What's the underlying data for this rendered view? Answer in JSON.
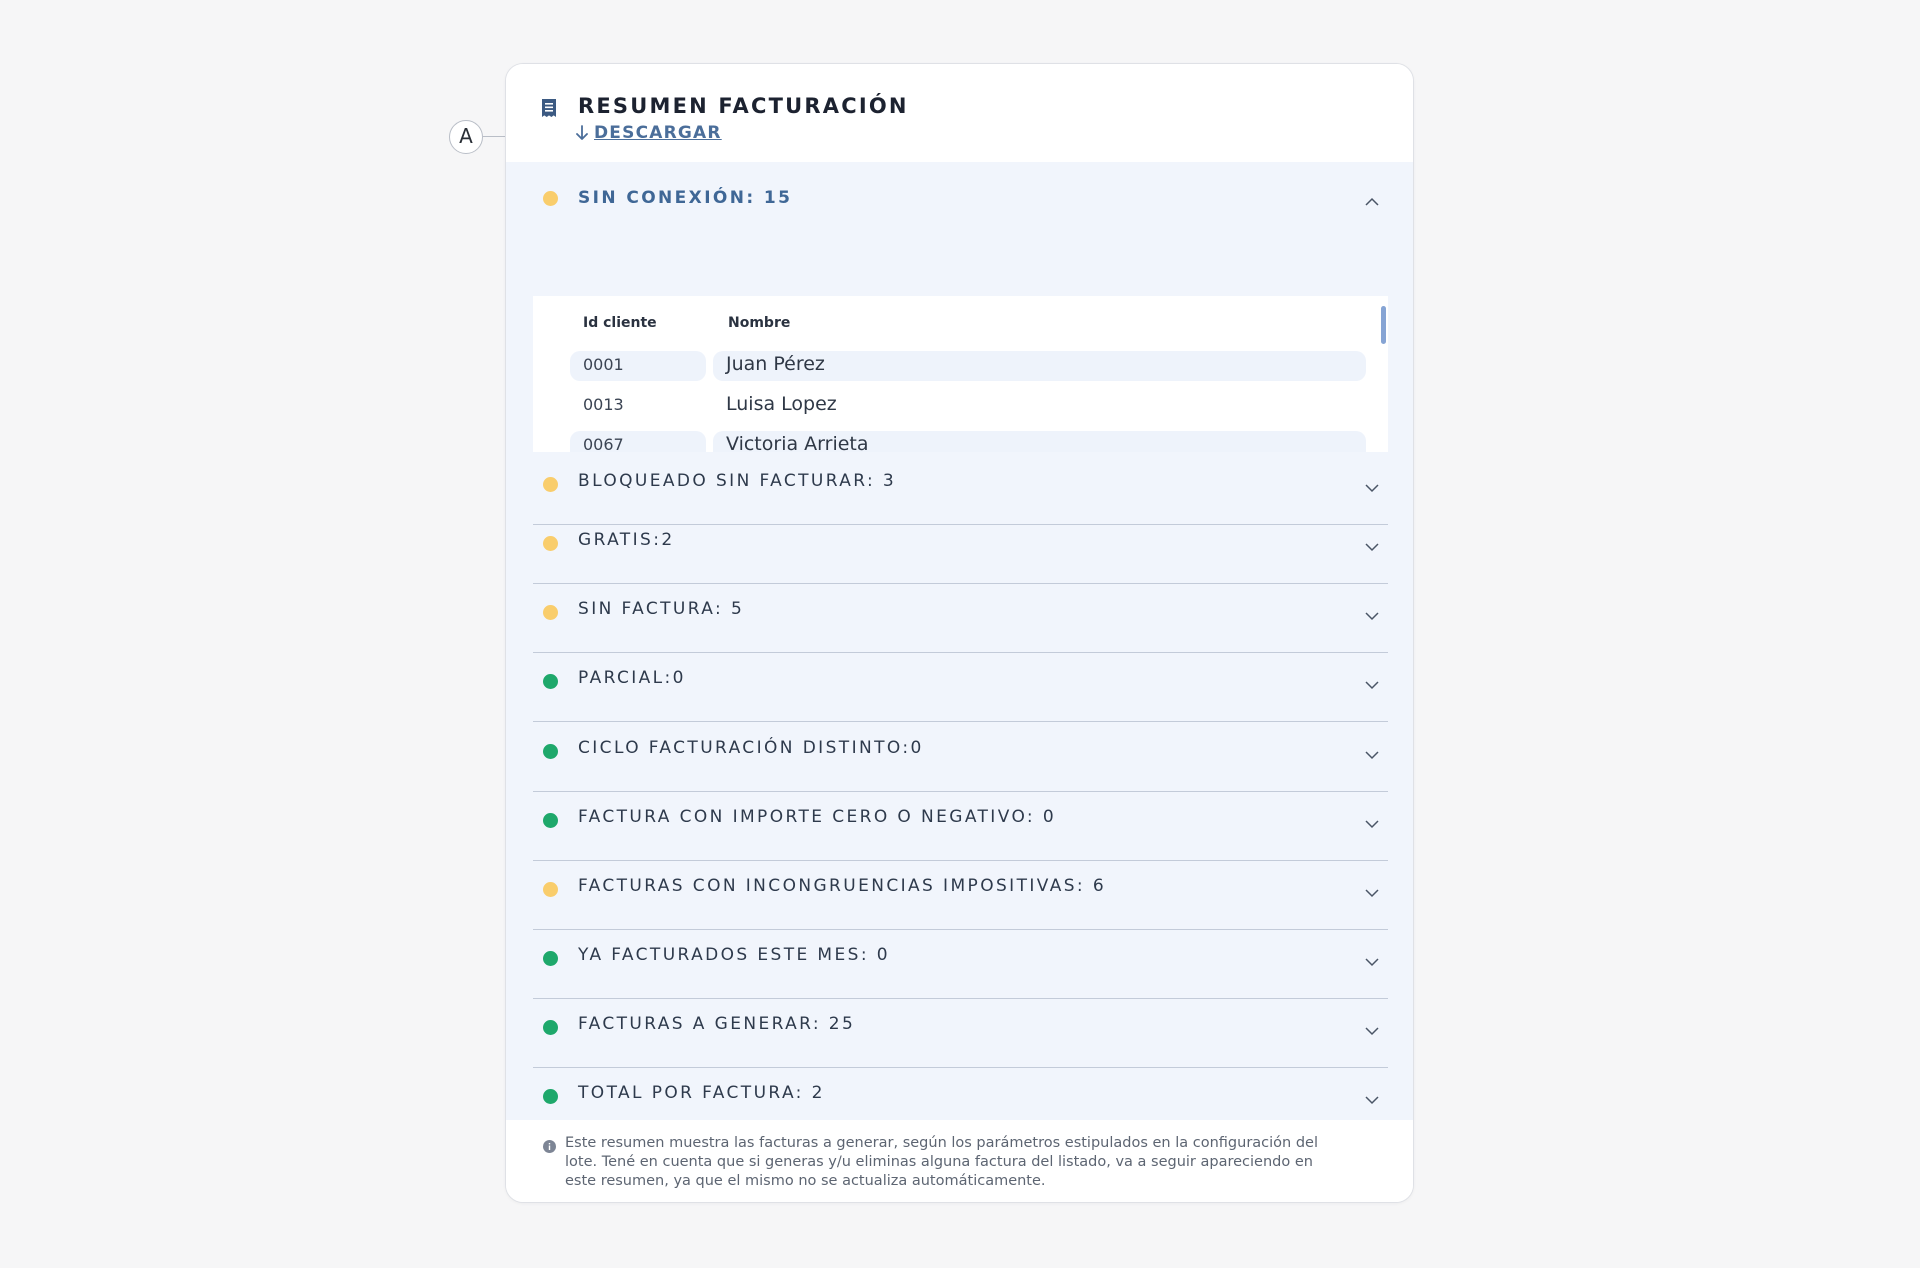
{
  "header": {
    "title": "RESUMEN FACTURACIÓN",
    "icon": "receipt-icon",
    "download_label": "DESCARGAR",
    "download_icon": "arrow-down-icon"
  },
  "callout": {
    "label": "A"
  },
  "colors": {
    "warning": "#f9cd6c",
    "success": "#1ea86b",
    "accent": "#3f6796",
    "panel_bg": "#f1f5fc"
  },
  "sections": [
    {
      "label": "SIN CONEXIÓN: 15",
      "status": "warning",
      "expanded": true
    },
    {
      "label": "BLOQUEADO SIN FACTURAR: 3",
      "status": "warning",
      "expanded": false
    },
    {
      "label": "GRATIS:2",
      "status": "warning",
      "expanded": false
    },
    {
      "label": "SIN FACTURA: 5",
      "status": "warning",
      "expanded": false
    },
    {
      "label": "PARCIAL:0",
      "status": "success",
      "expanded": false
    },
    {
      "label": "CICLO FACTURACIÓN DISTINTO:0",
      "status": "success",
      "expanded": false
    },
    {
      "label": "FACTURA CON IMPORTE CERO O NEGATIVO: 0",
      "status": "success",
      "expanded": false
    },
    {
      "label": "FACTURAS CON INCONGRUENCIAS IMPOSITIVAS: 6",
      "status": "warning",
      "expanded": false
    },
    {
      "label": "YA FACTURADOS ESTE MES: 0",
      "status": "success",
      "expanded": false
    },
    {
      "label": "FACTURAS A GENERAR: 25",
      "status": "success",
      "expanded": false
    },
    {
      "label": "TOTAL POR FACTURA: 2",
      "status": "success",
      "expanded": false
    }
  ],
  "table": {
    "columns": [
      "Id cliente",
      "Nombre"
    ],
    "rows": [
      {
        "id": "0001",
        "name": "Juan Pérez"
      },
      {
        "id": "0013",
        "name": "Luisa Lopez"
      },
      {
        "id": "0067",
        "name": "Victoria Arrieta"
      }
    ]
  },
  "footer": {
    "info_icon": "info-icon",
    "note": "Este resumen muestra las facturas a generar, según los parámetros estipulados en la configuración del lote. Tené en cuenta que si generas y/u eliminas alguna factura del listado, va a seguir apareciendo en este resumen, ya que el mismo no se actualiza automáticamente."
  }
}
